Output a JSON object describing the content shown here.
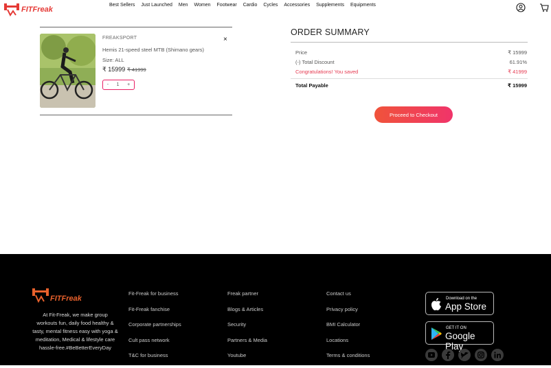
{
  "header": {
    "logo_text": "FITFreak",
    "nav": [
      "Best Sellers",
      "Just Launched",
      "Men",
      "Women",
      "Footwear",
      "Cardio",
      "Cycles",
      "Accessories",
      "Supplements",
      "Equipments"
    ],
    "icons": [
      "user-icon",
      "cart-icon"
    ]
  },
  "cart": {
    "item": {
      "brand": "FREAKSPORT",
      "name": "Hemis 21-speed steel MTB (Shimano gears)",
      "size": "Size: ALL",
      "price": "₹ 15999",
      "mrp": "₹ 41999",
      "remove": "×",
      "qty_minus": "-",
      "qty": "1",
      "qty_plus": "+"
    }
  },
  "summary": {
    "title": "ORDER SUMMARY",
    "rows": [
      {
        "label": "Price",
        "value": "₹ 15999"
      },
      {
        "label": "(-) Total Discount",
        "value": "61.91%"
      },
      {
        "label": "Congratulations! You saved",
        "value": "₹ 41999"
      }
    ],
    "total_label": "Total Payable",
    "total_value": "₹ 15999",
    "checkout_label": "Proceed to Checkout",
    "accent": "#f0346a"
  },
  "footer": {
    "logo_text": "FITFreak",
    "about": "At Fit-Freak, we make group workouts fun, daily food healthy & tasty, mental fitness easy with yoga & meditation, Medical & lifestyle care hassle-free.#BeBetterEveryDay",
    "col1": [
      "Fit-Freak for business",
      "Fit-Freak fanchise",
      "Corporate partnerships",
      "Cult pass network",
      "T&C for business"
    ],
    "col2": [
      "Freak partner",
      "Blogs & Articles",
      "Security",
      "Partners & Media",
      "Youtube"
    ],
    "col3": [
      "Contact us",
      "Privacy policy",
      "BMI Calculator",
      "Locations",
      "Terms & conditions"
    ],
    "appstore": {
      "small": "Download on the",
      "big": "App Store"
    },
    "playstore": {
      "small": "GET IT ON",
      "big": "Google Play"
    },
    "socials": [
      "youtube-icon",
      "facebook-icon",
      "twitter-icon",
      "instagram-icon",
      "linkedin-icon"
    ]
  }
}
